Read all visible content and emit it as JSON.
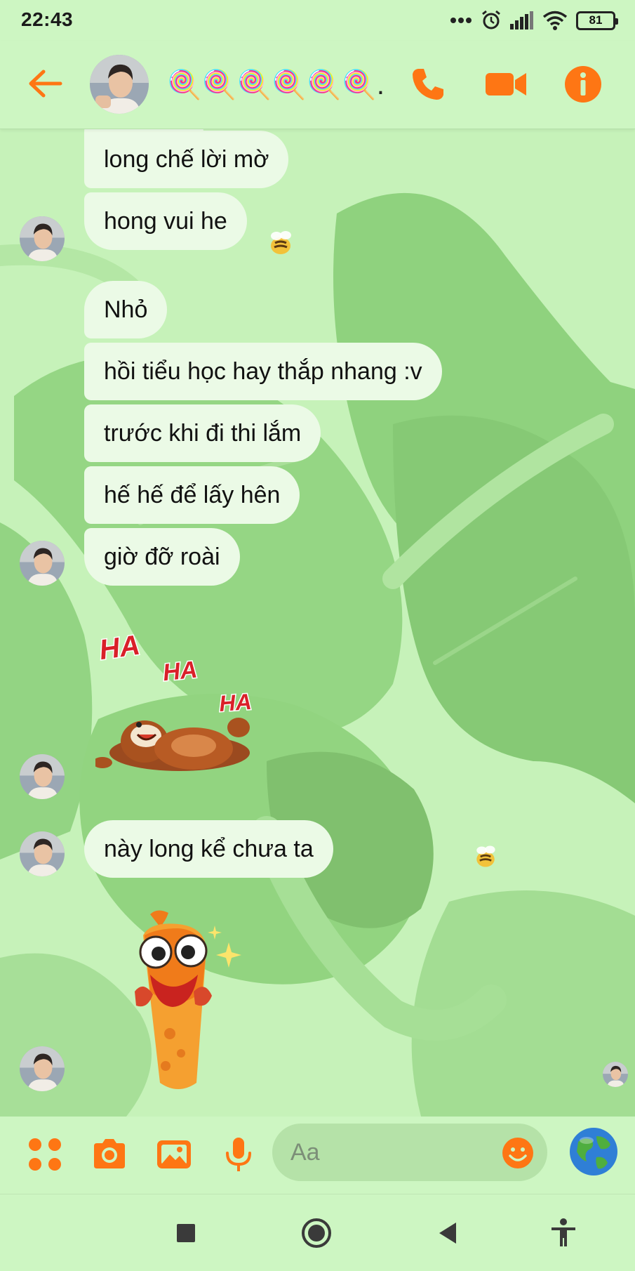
{
  "status_bar": {
    "time": "22:43",
    "battery": "81"
  },
  "header": {
    "contact_name": "🍭🍭🍭🍭🍭🍭...",
    "icons": [
      "back-arrow-icon",
      "phone-icon",
      "video-camera-icon",
      "info-icon"
    ],
    "accent_color": "#fe7614"
  },
  "messages": [
    {
      "text": "long chế lời mờ"
    },
    {
      "text": "hong vui he"
    },
    {
      "text": "Nhỏ"
    },
    {
      "text": "hồi tiểu học hay thắp nhang :v"
    },
    {
      "text": "trước khi đi thi lắm"
    },
    {
      "text": "hế hế để lấy hên"
    },
    {
      "text": "giờ đỡ roài"
    },
    {
      "text": "này long kể chưa ta"
    }
  ],
  "stickers": {
    "laughing_bear": {
      "letters": [
        "HA",
        "HA",
        "HA"
      ]
    },
    "excited_fish": {}
  },
  "composer": {
    "placeholder": "Aa",
    "icons": [
      "apps-grid-icon",
      "camera-icon",
      "image-icon",
      "microphone-icon",
      "emoji-icon",
      "globe-icon"
    ]
  },
  "navigation": {
    "icons": [
      "recents-square-icon",
      "home-circle-icon",
      "back-triangle-icon",
      "accessibility-icon"
    ]
  },
  "colors": {
    "background": "#cdf6c2",
    "bubble": "#ebfae6",
    "accent": "#fe7614",
    "input": "#b5e2a8"
  }
}
